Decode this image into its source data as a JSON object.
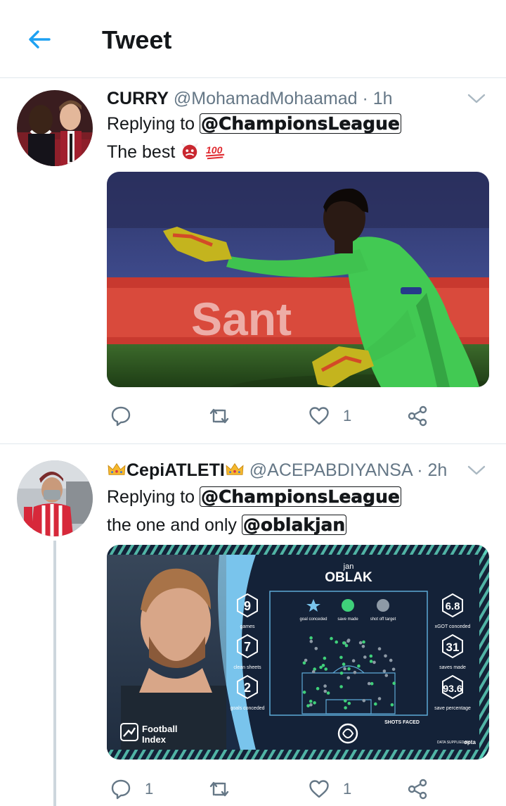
{
  "header": {
    "back_icon": "arrow-left-icon",
    "title": "Tweet",
    "accent": "#1da1f2"
  },
  "tweets": [
    {
      "display_name": "CURRY",
      "handle": "@MohamadMohaamad",
      "separator": "·",
      "time": "1h",
      "reply_prefix": "Replying to",
      "reply_to": "@ChampionsLeague",
      "text": "The best",
      "emojis": [
        "ogre-emoji",
        "hundred-points-emoji"
      ],
      "media": {
        "description": "goalkeeper-in-green-kit-photo",
        "banner_fragment": "Sant"
      },
      "actions": {
        "reply_count": "",
        "retweet_count": "",
        "like_count": "1"
      }
    },
    {
      "crown_icon": "crown-emoji",
      "display_name": "CepiATLETI",
      "handle": "@ACEPABDIYANSA",
      "separator": "·",
      "time": "2h",
      "reply_prefix": "Replying to",
      "reply_to": "@ChampionsLeague",
      "text": "the one and only",
      "text_mention": "@oblakjan",
      "media": {
        "first_name": "jan",
        "last_name": "OBLAK",
        "brand": "Football Index",
        "brand_line1": "Football",
        "brand_line2": "Index",
        "stats_left": [
          {
            "value": "9",
            "label": "games"
          },
          {
            "value": "7",
            "label": "clean sheets"
          },
          {
            "value": "2",
            "label": "goals conceded"
          }
        ],
        "stats_right": [
          {
            "value": "6.8",
            "label": "xGOT conceded"
          },
          {
            "value": "31",
            "label": "saves made"
          },
          {
            "value": "93.6",
            "label": "save percentage"
          }
        ],
        "legend": [
          {
            "label": "goal conceded"
          },
          {
            "label": "save made"
          },
          {
            "label": "shot off target"
          }
        ],
        "shots_title": "SHOTS FACED",
        "data_credit": "DATA SUPPLIED BY",
        "data_brand": "opta"
      },
      "actions": {
        "reply_count": "1",
        "retweet_count": "",
        "like_count": "1"
      }
    }
  ],
  "colors": {
    "text": "#14171a",
    "muted": "#657786",
    "border": "#e1e8ed",
    "kit_green": "#3fc24f"
  }
}
